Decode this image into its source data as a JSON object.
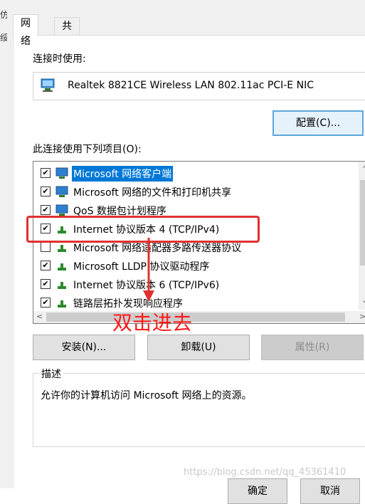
{
  "left_strip": [
    "仿",
    "绥"
  ],
  "tabs": [
    "网络",
    "共享"
  ],
  "connect_using_label": "连接时使用:",
  "adapter_name": "Realtek 8821CE Wireless LAN 802.11ac PCI-E NIC",
  "configure_button": "配置(C)...",
  "items_label": "此连接使用下列项目(O):",
  "items": [
    {
      "label": "Microsoft 网络客户端",
      "checked": true,
      "icon": "network-client-icon",
      "selected": true
    },
    {
      "label": "Microsoft 网络的文件和打印机共享",
      "checked": true,
      "icon": "file-share-icon",
      "selected": false
    },
    {
      "label": "QoS 数据包计划程序",
      "checked": true,
      "icon": "qos-icon",
      "selected": false
    },
    {
      "label": "Internet 协议版本 4 (TCP/IPv4)",
      "checked": true,
      "icon": "protocol-icon",
      "selected": false
    },
    {
      "label": "Microsoft 网络适配器多路传送器协议",
      "checked": false,
      "icon": "protocol-icon",
      "selected": false
    },
    {
      "label": "Microsoft LLDP 协议驱动程序",
      "checked": true,
      "icon": "protocol-icon",
      "selected": false
    },
    {
      "label": "Internet 协议版本 6 (TCP/IPv6)",
      "checked": true,
      "icon": "protocol-icon",
      "selected": false
    },
    {
      "label": "链路层拓扑发现响应程序",
      "checked": true,
      "icon": "protocol-icon",
      "selected": false
    }
  ],
  "install_button": "安装(N)...",
  "uninstall_button": "卸载(U)",
  "properties_button": "属性(R)",
  "description_title": "描述",
  "description_text": "允许你的计算机访问 Microsoft 网络上的资源。",
  "annotation": "双击进去",
  "watermark": "https://blog.csdn.net/qq_45361410",
  "ok_button": "确定",
  "cancel_button": "取消",
  "colors": {
    "selection": "#0078d7",
    "annotation": "#ff1a1a",
    "highlight_box": "#e03030"
  }
}
